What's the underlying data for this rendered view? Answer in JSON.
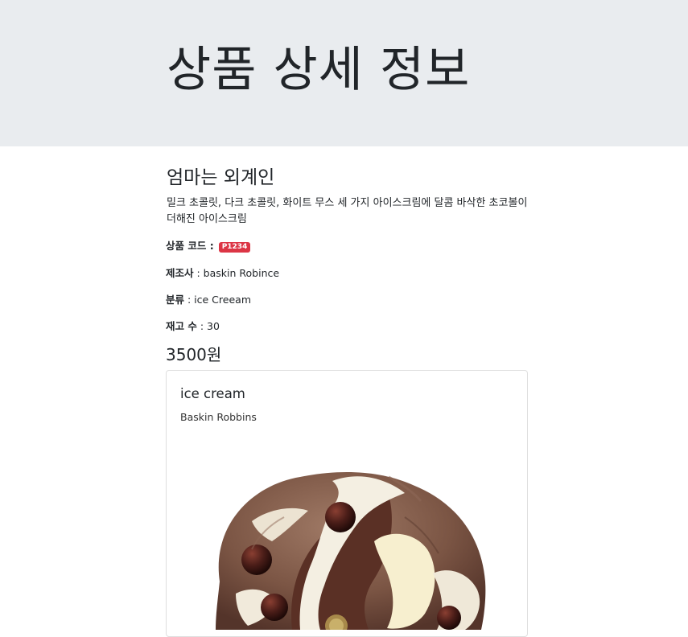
{
  "header": {
    "title": "상품 상세 정보"
  },
  "product": {
    "name": "엄마는 외계인",
    "description": "밀크 초콜릿, 다크 초콜릿, 화이트 무스 세 가지 아이스크림에 달콤 바삭한 초코볼이 더해진 아이스크림",
    "code_label": "상품 코드 :",
    "code": "P1234",
    "maker_label": "제조사",
    "maker": " : baskin Robince",
    "category_label": "분류",
    "category": " : ice Creeam",
    "stock_label": "재고 수",
    "stock": " : 30",
    "price": "3500원"
  },
  "card": {
    "title": "ice cream",
    "subtitle": "Baskin Robbins",
    "image_icon": "ice-cream-scoop-image"
  },
  "colors": {
    "jumbotron_bg": "#e9ecef",
    "badge_bg": "#dc3545"
  }
}
